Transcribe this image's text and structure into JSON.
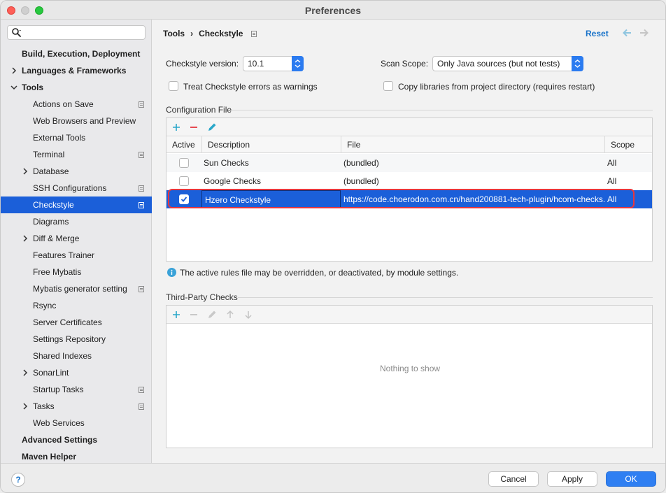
{
  "window": {
    "title": "Preferences"
  },
  "sidebar": {
    "search_placeholder": "",
    "items": [
      {
        "label": "Build, Execution, Deployment",
        "level": 0,
        "bold": true
      },
      {
        "label": "Languages & Frameworks",
        "level": 0,
        "bold": true,
        "chevron": "right"
      },
      {
        "label": "Tools",
        "level": 0,
        "bold": true,
        "chevron": "down"
      },
      {
        "label": "Actions on Save",
        "level": 1,
        "badge": true
      },
      {
        "label": "Web Browsers and Preview",
        "level": 1
      },
      {
        "label": "External Tools",
        "level": 1
      },
      {
        "label": "Terminal",
        "level": 1,
        "badge": true
      },
      {
        "label": "Database",
        "level": 1,
        "chevron": "right"
      },
      {
        "label": "SSH Configurations",
        "level": 1,
        "badge": true
      },
      {
        "label": "Checkstyle",
        "level": 1,
        "badge": true,
        "selected": true
      },
      {
        "label": "Diagrams",
        "level": 1
      },
      {
        "label": "Diff & Merge",
        "level": 1,
        "chevron": "right"
      },
      {
        "label": "Features Trainer",
        "level": 1
      },
      {
        "label": "Free Mybatis",
        "level": 1
      },
      {
        "label": "Mybatis generator setting",
        "level": 1,
        "badge": true
      },
      {
        "label": "Rsync",
        "level": 1
      },
      {
        "label": "Server Certificates",
        "level": 1
      },
      {
        "label": "Settings Repository",
        "level": 1
      },
      {
        "label": "Shared Indexes",
        "level": 1
      },
      {
        "label": "SonarLint",
        "level": 1,
        "chevron": "right"
      },
      {
        "label": "Startup Tasks",
        "level": 1,
        "badge": true
      },
      {
        "label": "Tasks",
        "level": 1,
        "chevron": "right",
        "badge": true
      },
      {
        "label": "Web Services",
        "level": 1
      },
      {
        "label": "Advanced Settings",
        "level": 0,
        "bold": true
      },
      {
        "label": "Maven Helper",
        "level": 0,
        "bold": true
      }
    ]
  },
  "header": {
    "breadcrumb_parent": "Tools",
    "breadcrumb_sep": "›",
    "breadcrumb_current": "Checkstyle",
    "reset_label": "Reset"
  },
  "settings": {
    "version_label": "Checkstyle version:",
    "version_value": "10.1",
    "scope_label": "Scan Scope:",
    "scope_value": "Only Java sources (but not tests)",
    "treat_errors_label": "Treat Checkstyle errors as warnings",
    "copy_libs_label": "Copy libraries from project directory (requires restart)"
  },
  "config_file": {
    "title": "Configuration File",
    "columns": [
      "Active",
      "Description",
      "File",
      "Scope"
    ],
    "rows": [
      {
        "active": false,
        "description": "Sun Checks",
        "file": "(bundled)",
        "scope": "All"
      },
      {
        "active": false,
        "description": "Google Checks",
        "file": "(bundled)",
        "scope": "All"
      },
      {
        "active": true,
        "description": "Hzero Checkstyle",
        "file": "https://code.choerodon.com.cn/hand200881-tech-plugin/hcom-checks...",
        "scope": "All",
        "selected": true
      }
    ],
    "info_text": "The active rules file may be overridden, or deactivated, by module settings."
  },
  "third_party": {
    "title": "Third-Party Checks",
    "empty_text": "Nothing to show"
  },
  "footer": {
    "help_label": "?",
    "cancel_label": "Cancel",
    "apply_label": "Apply",
    "ok_label": "OK"
  },
  "colors": {
    "accent": "#1b5fd9",
    "primary_button": "#2f7ff2",
    "add_icon": "#2aa7c9",
    "remove_icon": "#e5373f",
    "highlight_border": "#e5373f"
  }
}
